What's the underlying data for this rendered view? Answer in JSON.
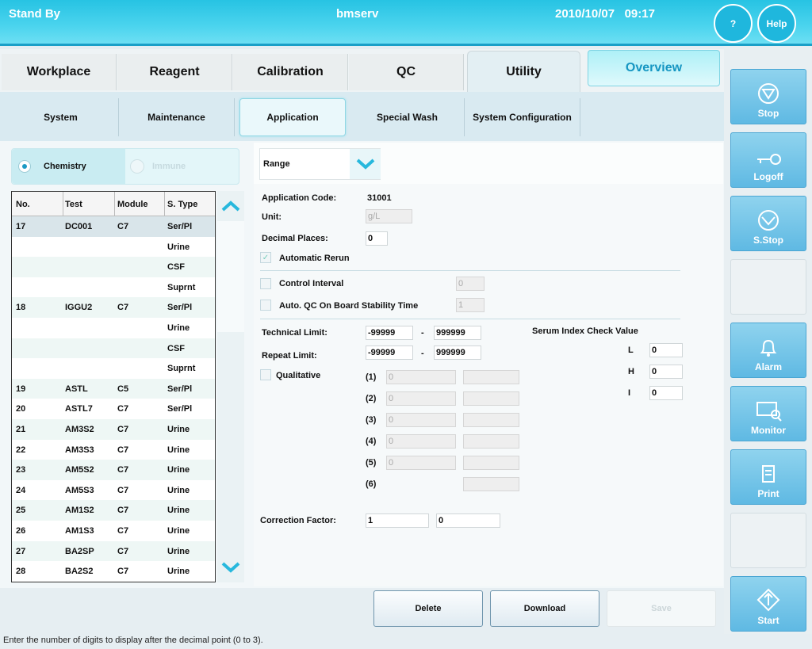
{
  "header": {
    "status": "Stand By",
    "title": "bmserv",
    "datetime": "2010/10/07   09:17",
    "pointer_btn": "?",
    "help_btn": "Help"
  },
  "tabs": [
    "Workplace",
    "Reagent",
    "Calibration",
    "QC",
    "Utility",
    "Overview"
  ],
  "active_tab": "Utility",
  "subtabs": [
    "System",
    "Maintenance",
    "Application",
    "Special Wash",
    "System Configuration"
  ],
  "active_subtab": "Application",
  "mode": {
    "chemistry": "Chemistry",
    "immune": "Immune",
    "selected": "Chemistry"
  },
  "table": {
    "headers": [
      "No.",
      "Test",
      "Module",
      "S. Type"
    ],
    "rows": [
      [
        "17",
        "DC001",
        "C7",
        "Ser/Pl"
      ],
      [
        "",
        "",
        "",
        "Urine"
      ],
      [
        "",
        "",
        "",
        "CSF"
      ],
      [
        "",
        "",
        "",
        "Suprnt"
      ],
      [
        "18",
        "IGGU2",
        "C7",
        "Ser/Pl"
      ],
      [
        "",
        "",
        "",
        "Urine"
      ],
      [
        "",
        "",
        "",
        "CSF"
      ],
      [
        "",
        "",
        "",
        "Suprnt"
      ],
      [
        "19",
        "ASTL",
        "C5",
        "Ser/Pl"
      ],
      [
        "20",
        "ASTL7",
        "C7",
        "Ser/Pl"
      ],
      [
        "21",
        "AM3S2",
        "C7",
        "Urine"
      ],
      [
        "22",
        "AM3S3",
        "C7",
        "Urine"
      ],
      [
        "23",
        "AM5S2",
        "C7",
        "Urine"
      ],
      [
        "24",
        "AM5S3",
        "C7",
        "Urine"
      ],
      [
        "25",
        "AM1S2",
        "C7",
        "Urine"
      ],
      [
        "26",
        "AM1S3",
        "C7",
        "Urine"
      ],
      [
        "27",
        "BA2SP",
        "C7",
        "Urine"
      ],
      [
        "28",
        "BA2S2",
        "C7",
        "Urine"
      ]
    ]
  },
  "form": {
    "dropdown": "Range",
    "app_code_label": "Application Code:",
    "app_code": "31001",
    "unit_label": "Unit:",
    "unit": "g/L",
    "decimal_label": "Decimal Places:",
    "decimal": "0",
    "auto_rerun": "Automatic Rerun",
    "control_interval": "Control Interval",
    "control_interval_val": "0",
    "auto_qc": "Auto. QC On Board Stability Time",
    "auto_qc_val": "1",
    "tech_limit_label": "Technical Limit:",
    "tech_low": "-99999",
    "tech_high": "999999",
    "repeat_limit_label": "Repeat Limit:",
    "rep_low": "-99999",
    "rep_high": "999999",
    "dash": "-",
    "qualitative": "Qualitative",
    "qual_rows": [
      {
        "n": "(1)",
        "a": "0",
        "b": ""
      },
      {
        "n": "(2)",
        "a": "0",
        "b": ""
      },
      {
        "n": "(3)",
        "a": "0",
        "b": ""
      },
      {
        "n": "(4)",
        "a": "0",
        "b": ""
      },
      {
        "n": "(5)",
        "a": "0",
        "b": ""
      },
      {
        "n": "(6)",
        "a": "",
        "b": ""
      }
    ],
    "serum_title": "Serum Index Check Value",
    "serum": [
      {
        "k": "L",
        "v": "0"
      },
      {
        "k": "H",
        "v": "0"
      },
      {
        "k": "I",
        "v": "0"
      }
    ],
    "correction_label": "Correction Factor:",
    "corr1": "1",
    "corr2": "0"
  },
  "buttons": {
    "delete": "Delete",
    "download": "Download",
    "save": "Save"
  },
  "side": [
    "Stop",
    "Logoff",
    "S.Stop",
    "Alarm",
    "Monitor",
    "Print",
    "Start"
  ],
  "statusbar": "Enter the number of digits to display after the decimal point (0 to 3)."
}
